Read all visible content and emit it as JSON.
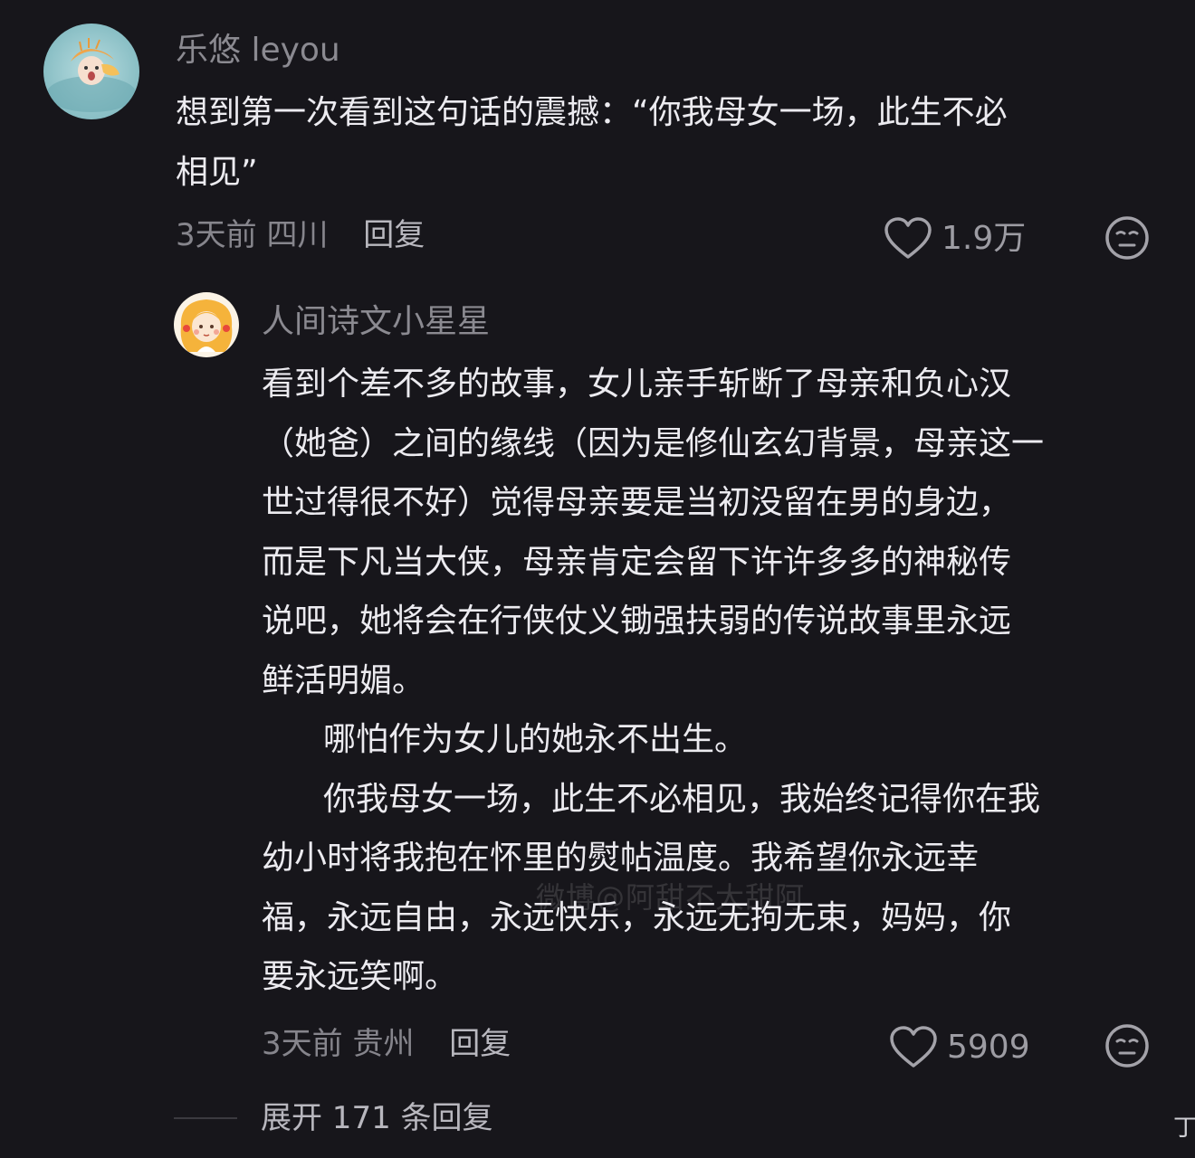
{
  "comments": [
    {
      "username": "乐悠 leyou",
      "content_lines": [
        "想到第一次看到这句话的震撼：“你我母女一场，此生不必",
        "相见”"
      ],
      "time": "3天前",
      "location": "四川",
      "reply_label": "回复",
      "likes": "1.9万"
    },
    {
      "username": "人间诗文小星星",
      "content_lines": [
        "看到个差不多的故事，女儿亲手斩断了母亲和负心汉",
        "（她爸）之间的缘线（因为是修仙玄幻背景，母亲这一",
        "世过得很不好）觉得母亲要是当初没留在男的身边，",
        "而是下凡当大侠，母亲肯定会留下许许多多的神秘传",
        "说吧，她将会在行侠仗义锄强扶弱的传说故事里永远",
        "鲜活明媚。"
      ],
      "paragraph_2": "哪怕作为女儿的她永不出生。",
      "paragraph_3_lines": [
        "你我母女一场，此生不必相见，我始终记得你在我",
        "幼小时将我抱在怀里的熨帖温度。我希望你永远幸",
        "福，永远自由，永远快乐，永远无拘无束，妈妈，你",
        "要永远笑啊。"
      ],
      "time": "3天前",
      "location": "贵州",
      "reply_label": "回复",
      "likes": "5909"
    }
  ],
  "expand_replies": "展开 171 条回复",
  "watermark": "微博@阿甜不大甜阿",
  "corner_glyph": "丁",
  "colors": {
    "background": "#17161b",
    "text": "#ecebf0",
    "muted": "#8b8a91"
  },
  "icons": {
    "like": "heart-outline-icon",
    "dislike": "unamused-face-icon"
  }
}
